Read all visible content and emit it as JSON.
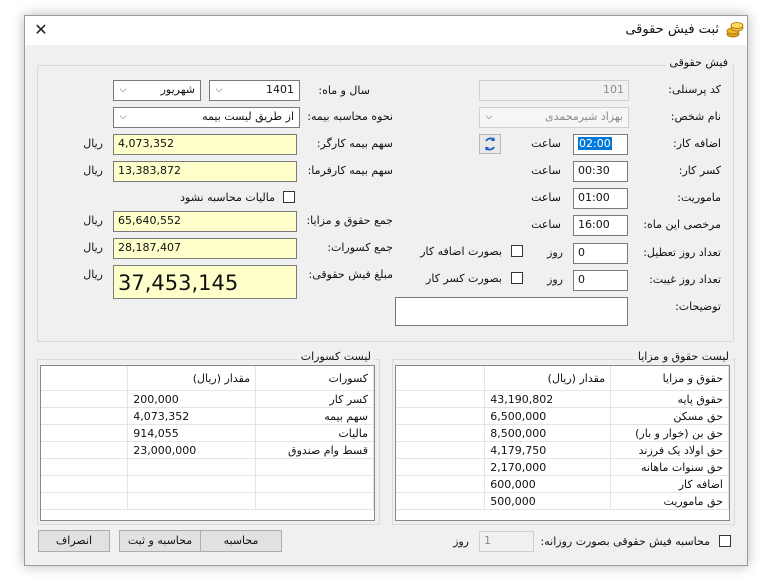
{
  "window": {
    "title": "ثبت فیش حقوقی",
    "close_glyph": "✕"
  },
  "payslip_group": {
    "title": "فیش حقوقی",
    "personnel_code_label": "کد پرسنلی:",
    "personnel_code": "101",
    "person_name_label": "نام شخص:",
    "person_name": "بهزاد شیرمحمدی",
    "year_month_label": "سال و ماه:",
    "year": "1401",
    "month": "شهریور",
    "insurance_method_label": "نحوه محاسبه بیمه:",
    "insurance_method": "از طریق لیست بیمه",
    "worker_insurance_label": "سهم بیمه کارگر:",
    "worker_insurance": "4,073,352",
    "employer_insurance_label": "سهم بیمه کارفرما:",
    "employer_insurance": "13,383,872",
    "currency": "ریال",
    "no_tax_label": "مالیات محاسبه نشود",
    "total_salary_label": "جمع حقوق و مزایا:",
    "total_salary": "65,640,552",
    "total_deductions_label": "جمع کسورات:",
    "total_deductions": "28,187,407",
    "payslip_amount_label": "مبلغ فیش حقوقی:",
    "payslip_amount": "37,453,145",
    "overtime_label": "اضافه کار:",
    "overtime_value": "02:00",
    "hour_unit": "ساعت",
    "work_deficit_label": "کسر کار:",
    "work_deficit_value": "00:30",
    "mission_label": "ماموریت:",
    "mission_value": "01:00",
    "leave_label": "مرخصی این ماه:",
    "leave_value": "16:00",
    "holidays_label": "تعداد روز تعطیل:",
    "holidays_value": "0",
    "absence_label": "تعداد روز غیبت:",
    "absence_value": "0",
    "day_unit": "روز",
    "as_overtime_label": "بصورت اضافه کار",
    "as_deficit_label": "بصورت کسر کار",
    "description_label": "توضیحات:",
    "description_value": ""
  },
  "salary_list": {
    "title": "لیست حقوق و مزایا",
    "col_name": "حقوق و مزایا",
    "col_amount": "مقدار (ریال)",
    "rows": [
      {
        "name": "حقوق پایه",
        "amount": "43,190,802"
      },
      {
        "name": "حق مسکن",
        "amount": "6,500,000"
      },
      {
        "name": "حق بن (خوار و بار)",
        "amount": "8,500,000"
      },
      {
        "name": "حق اولاد یک فرزند",
        "amount": "4,179,750"
      },
      {
        "name": "حق سنوات ماهانه",
        "amount": "2,170,000"
      },
      {
        "name": "اضافه کار",
        "amount": "600,000"
      },
      {
        "name": "حق ماموریت",
        "amount": "500,000"
      }
    ]
  },
  "deduction_list": {
    "title": "لیست کسورات",
    "col_name": "کسورات",
    "col_amount": "مقدار (ریال)",
    "rows": [
      {
        "name": "کسر کار",
        "amount": "200,000"
      },
      {
        "name": "سهم بیمه",
        "amount": "4,073,352"
      },
      {
        "name": "مالیات",
        "amount": "914,055"
      },
      {
        "name": "قسط وام صندوق",
        "amount": "23,000,000"
      }
    ]
  },
  "footer": {
    "daily_calc_label": "محاسبه فیش حقوقی بصورت روزانه:",
    "daily_days_value": "1",
    "days_unit": "روز",
    "calculate_label": "محاسبه",
    "calculate_save_label": "محاسبه و ثبت",
    "cancel_label": "انصراف"
  }
}
